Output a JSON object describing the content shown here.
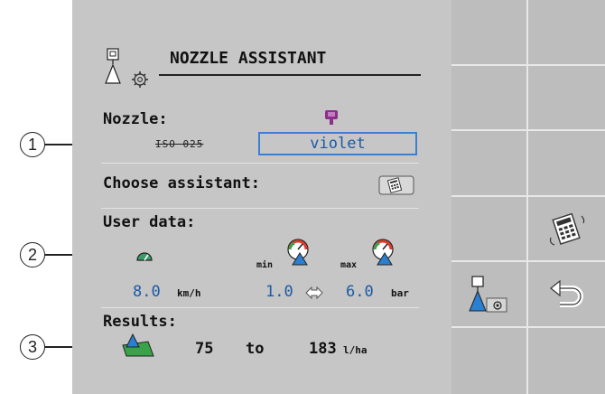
{
  "screen": {
    "title": "NOZZLE ASSISTANT",
    "nozzle_label": "Nozzle:",
    "nozzle_old": "ISO 025",
    "nozzle_value": "violet",
    "choose_assistant_label": "Choose assistant:",
    "user_data_label": "User data:",
    "speed_value": "8.0",
    "speed_unit": "km/h",
    "min_label": "min",
    "max_label": "max",
    "pressure_min": "1.0",
    "pressure_max": "6.0",
    "pressure_unit": "bar",
    "results_label": "Results:",
    "result_low": "75",
    "result_to": "to",
    "result_high": "183",
    "result_unit": "l/ha"
  },
  "callouts": [
    "1",
    "2",
    "3"
  ],
  "icons": {
    "nozzle": "violet-nozzle-icon",
    "speed": "speedometer-icon",
    "pressure": "pressure-gauge-icon",
    "assistant": "calculator-icon",
    "back": "return-arrow-icon"
  },
  "colors": {
    "panel": "#c6c6c6",
    "softkey": "#bdbdbd",
    "value_blue": "#1a5aa8",
    "nozzle_violet": "#8b2f8b",
    "field_green": "#3aa34a"
  }
}
